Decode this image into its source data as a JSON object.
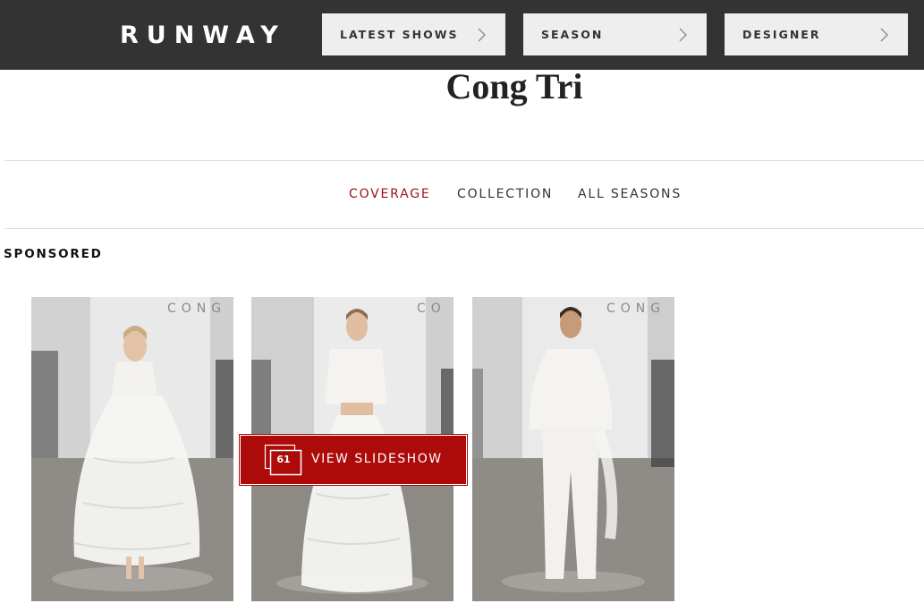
{
  "header": {
    "logo": "RUNWAY",
    "nav": [
      {
        "label": "LATEST SHOWS"
      },
      {
        "label": "SEASON"
      },
      {
        "label": "DESIGNER"
      }
    ]
  },
  "designer": {
    "name": "Cong Tri"
  },
  "subnav": {
    "items": [
      {
        "label": "COVERAGE",
        "active": true
      },
      {
        "label": "COLLECTION",
        "active": false
      },
      {
        "label": "ALL SEASONS",
        "active": false
      }
    ]
  },
  "sponsored_label": "SPONSORED",
  "gallery": {
    "wall_text": [
      "CONG",
      "CO",
      "CONG"
    ],
    "slideshow": {
      "count": "61",
      "label": "VIEW SLIDESHOW"
    }
  },
  "colors": {
    "header_bg": "#333333",
    "accent": "#9b1118",
    "button_red": "#ad0a0a"
  },
  "icons": [
    "chevron-right-icon",
    "stacked-photos-icon"
  ]
}
